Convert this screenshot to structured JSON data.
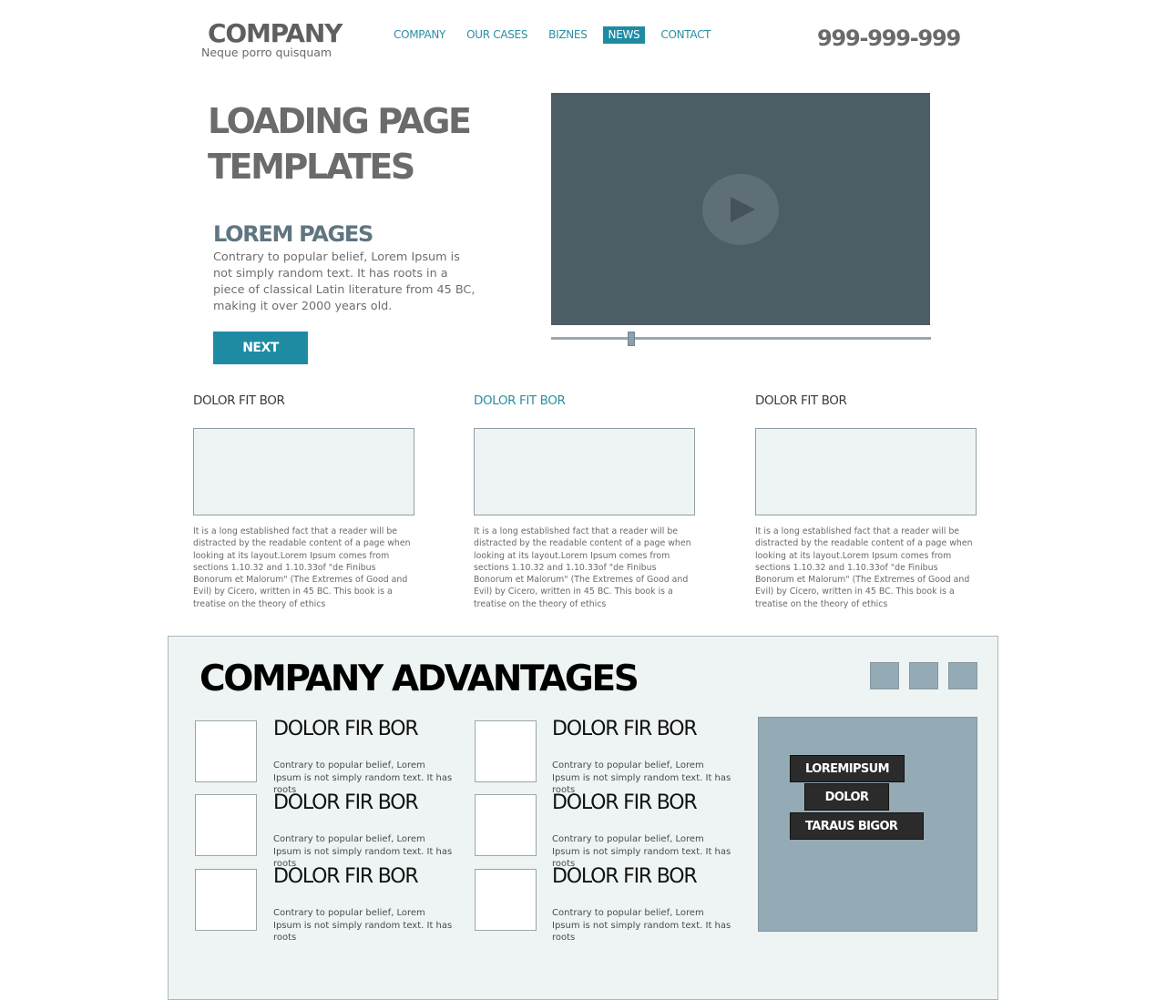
{
  "header": {
    "logo": "COMPANY",
    "tagline": "Neque porro quisquam",
    "nav": [
      {
        "label": "COMPANY",
        "active": false
      },
      {
        "label": "OUR CASES",
        "active": false
      },
      {
        "label": "BIZNES",
        "active": false
      },
      {
        "label": "NEWS",
        "active": true
      },
      {
        "label": "CONTACT",
        "active": false
      }
    ],
    "phone": "999-999-999"
  },
  "hero": {
    "title_line1": "LOADING PAGE",
    "title_line2": "TEMPLATES",
    "subtitle": "LOREM PAGES",
    "text": "Contrary to popular belief, Lorem Ipsum is not simply random text. It has roots in a piece of classical Latin literature from 45 BC, making it over 2000 years old.",
    "button": "NEXT",
    "video": {
      "play_icon": "play-icon",
      "progress_fraction": 0.21
    }
  },
  "columns": [
    {
      "title": "DOLOR FIT BOR",
      "text": "It is a long established fact that a reader will be distracted by the readable content of a page when looking at its layout.Lorem Ipsum comes from sections 1.10.32 and 1.10.33of \"de Finibus Bonorum et Malorum\" (The Extremes of Good and Evil) by Cicero, written in 45 BC. This book is a treatise on the theory of ethics"
    },
    {
      "title": "DOLOR FIT BOR",
      "text": "It is a long established fact that a reader will be distracted by the readable content of a page when looking at its layout.Lorem Ipsum comes from sections 1.10.32 and 1.10.33of \"de Finibus Bonorum et Malorum\" (The Extremes of Good and Evil) by Cicero, written in 45 BC. This book is a treatise on the theory of ethics"
    },
    {
      "title": "DOLOR FIT BOR",
      "text": "It is a long established fact that a reader will be distracted by the readable content of a page when looking at its layout.Lorem Ipsum comes from sections 1.10.32 and 1.10.33of \"de Finibus Bonorum et Malorum\" (The Extremes of Good and Evil) by Cicero, written in 45 BC. This book is a treatise on the theory of ethics"
    }
  ],
  "advantages": {
    "title": "COMPANY ADVANTAGES",
    "items": [
      {
        "title": "DOLOR FIR BOR",
        "text": "Contrary to popular belief, Lorem Ipsum is not simply random text. It has roots"
      },
      {
        "title": "DOLOR FIR BOR",
        "text": "Contrary to popular belief, Lorem Ipsum is not simply random text. It has roots"
      },
      {
        "title": "DOLOR FIR BOR",
        "text": "Contrary to popular belief, Lorem Ipsum is not simply random text. It has roots"
      },
      {
        "title": "DOLOR FIR BOR",
        "text": "Contrary to popular belief, Lorem Ipsum is not simply random text. It has roots"
      },
      {
        "title": "DOLOR FIR BOR",
        "text": "Contrary to popular belief, Lorem Ipsum is not simply random text. It has roots"
      },
      {
        "title": "DOLOR FIR BOR",
        "text": "Contrary to popular belief, Lorem Ipsum is not simply random text. It has roots"
      }
    ],
    "tags": [
      "LOREMIPSUM",
      "DOLOR",
      "TARAUS BIGOR"
    ]
  },
  "colors": {
    "accent": "#1f8ba3",
    "video_bg": "#4d5d65",
    "panel_bg": "#94aab5",
    "section_bg": "#eef4f4"
  }
}
